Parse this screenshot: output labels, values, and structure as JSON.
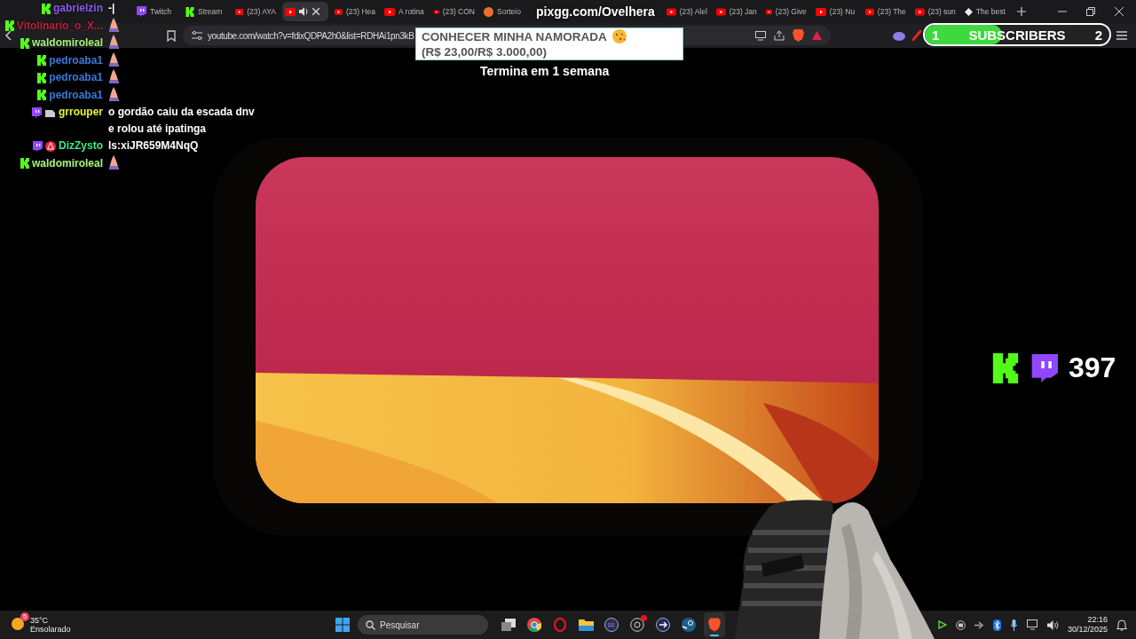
{
  "browser": {
    "tabs": [
      {
        "kind": "twitch",
        "title": "Twitch",
        "selected": false,
        "audio": false
      },
      {
        "kind": "kick",
        "title": "Stream",
        "selected": false,
        "audio": false
      },
      {
        "kind": "youtube",
        "title": "(23) AYA",
        "selected": false,
        "audio": false
      },
      {
        "kind": "youtube",
        "selected": true,
        "audio": true
      },
      {
        "kind": "youtube",
        "title": "(23) Hea",
        "selected": false,
        "audio": false
      },
      {
        "kind": "youtube",
        "title": "A rotina",
        "selected": false,
        "audio": false
      },
      {
        "kind": "youtube",
        "title": "(23) CON",
        "selected": false,
        "audio": false
      },
      {
        "kind": "raffle",
        "title": "Sorteio",
        "selected": false,
        "audio": false
      },
      {
        "kind": "youtube",
        "title": "(23) Alel",
        "selected": false,
        "audio": false
      },
      {
        "kind": "youtube",
        "title": "(23) Jan",
        "selected": false,
        "audio": false
      },
      {
        "kind": "youtube",
        "title": "(23) Give",
        "selected": false,
        "audio": false
      },
      {
        "kind": "youtube",
        "title": "(23) Nu",
        "selected": false,
        "audio": false
      },
      {
        "kind": "youtube",
        "title": "(23) The",
        "selected": false,
        "audio": false
      },
      {
        "kind": "youtube",
        "title": "(23) sun",
        "selected": false,
        "audio": false
      },
      {
        "kind": "site",
        "title": "The best",
        "selected": false,
        "audio": false
      }
    ],
    "url": "youtube.com/watch?v=fdixQDPA2h0&list=RDHAi1pn3kB"
  },
  "overlay": {
    "pix_link": "pixgg.com/Ovelhera",
    "goal": {
      "title": "CONHECER MINHA NAMORADA",
      "amount": "(R$ 23,00/R$ 3.000,00)",
      "ends": "Termina em 1 semana"
    },
    "subscriber_goal": {
      "start": "1",
      "label": "SUBSCRIBERS",
      "end": "2",
      "level": 0.42
    },
    "viewers": "397",
    "chat": [
      {
        "badges": [
          {
            "kind": "kick"
          }
        ],
        "user": "gabrielzin",
        "color": "#8a5cf0",
        "message": "-|",
        "emote": false
      },
      {
        "badges": [
          {
            "kind": "kick"
          }
        ],
        "user": "Vitolinario_o_X...",
        "color": "#c0203c",
        "emote": true
      },
      {
        "badges": [
          {
            "kind": "kick"
          }
        ],
        "user": "waldomiroleal",
        "color": "#a8f57a",
        "emote": true
      },
      {
        "badges": [
          {
            "kind": "kick"
          }
        ],
        "user": "pedroaba1",
        "color": "#3b78d8",
        "emote": true
      },
      {
        "badges": [
          {
            "kind": "kick"
          }
        ],
        "user": "pedroaba1",
        "color": "#3b78d8",
        "emote": true
      },
      {
        "badges": [
          {
            "kind": "kick"
          }
        ],
        "user": "pedroaba1",
        "color": "#3b78d8",
        "emote": true
      },
      {
        "badges": [
          {
            "kind": "twitch"
          },
          {
            "kind": "gear"
          }
        ],
        "user": "grrouper",
        "color": "#e8f43c",
        "message": "o gordão caiu da escada dnv e rolou até ipatinga",
        "emote": false
      },
      {
        "badges": [
          {
            "kind": "twitch"
          },
          {
            "kind": "alert"
          }
        ],
        "user": "DizZysto",
        "color": "#3ee88c",
        "message": "ls:xiJR659M4NqQ",
        "emote": false
      },
      {
        "badges": [
          {
            "kind": "kick"
          }
        ],
        "user": "waldomiroleal",
        "color": "#a8f57a",
        "emote": true
      }
    ]
  },
  "taskbar": {
    "weather": {
      "badge": "5",
      "temperature": "35°C",
      "condition": "Ensolarado"
    },
    "search": {
      "placeholder": "Pesquisar"
    },
    "apps": [
      {
        "kind": "taskview",
        "active": false,
        "notification": false
      },
      {
        "kind": "chrome",
        "active": false,
        "notification": false
      },
      {
        "kind": "opera",
        "active": false,
        "notification": false
      },
      {
        "kind": "folder",
        "active": false,
        "notification": false
      },
      {
        "kind": "keyboard",
        "active": false,
        "notification": false
      },
      {
        "kind": "obs",
        "active": false,
        "notification": true
      },
      {
        "kind": "arrow",
        "active": false,
        "notification": false
      },
      {
        "kind": "steam",
        "active": false,
        "notification": false
      },
      {
        "kind": "brave",
        "active": true,
        "notification": false
      }
    ],
    "clock": {
      "time": "22:16",
      "date": "30/12/2025"
    }
  }
}
